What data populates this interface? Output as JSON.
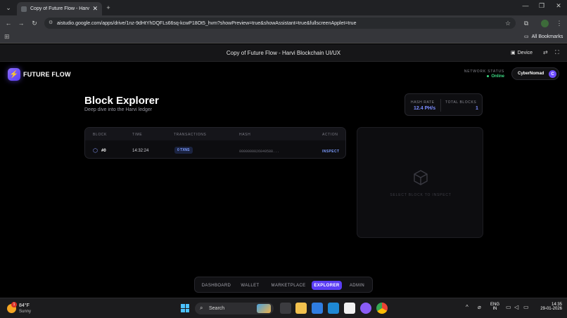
{
  "browser": {
    "tab_title": "Copy of Future Flow - Harvi Bl",
    "url": "aistudio.google.com/apps/drive/1nz-9dHtYhDQFLs66sq-kcwP18Ot5_hvm?showPreview=true&showAssistant=true&fullscreenApplet=true",
    "bookmarks_label": "All Bookmarks"
  },
  "applet": {
    "title": "Copy of Future Flow - Harvi Blockchain UI/UX",
    "device_label": "Device"
  },
  "app": {
    "brand": "FUTURE FLOW",
    "network_status_label": "NETWORK STATUS",
    "network_status_value": "Online",
    "user_name": "CyberNomad",
    "user_initial": "C",
    "page_title": "Block Explorer",
    "page_subtitle": "Deep dive into the Harvi ledger",
    "stats": {
      "hash_rate_label": "HASH RATE",
      "hash_rate_value": "12.4 PH/s",
      "total_blocks_label": "TOTAL BLOCKS",
      "total_blocks_value": "1"
    },
    "table": {
      "headers": [
        "BLOCK",
        "TIME",
        "TRANSACTIONS",
        "HASH",
        "ACTION"
      ],
      "rows": [
        {
          "block": "#0",
          "time": "14:32:24",
          "transactions": "0 TXNS",
          "hash": "0000000026049588...",
          "action": "INSPECT"
        }
      ]
    },
    "inspect_placeholder": "SELECT BLOCK TO INSPECT",
    "nav": [
      "DASHBOARD",
      "WALLET",
      "MARKETPLACE",
      "EXPLORER",
      "ADMIN"
    ],
    "nav_active": "EXPLORER"
  },
  "taskbar": {
    "weather_temp": "84°F",
    "weather_desc": "Sunny",
    "weather_badge": "1",
    "search_label": "Search",
    "lang_top": "ENG",
    "lang_bottom": "IN",
    "time": "14:35",
    "date": "29-01-2026"
  },
  "colors": {
    "accent": "#5b3df5",
    "online": "#3ddc84",
    "stat_value": "#7b8cff"
  }
}
